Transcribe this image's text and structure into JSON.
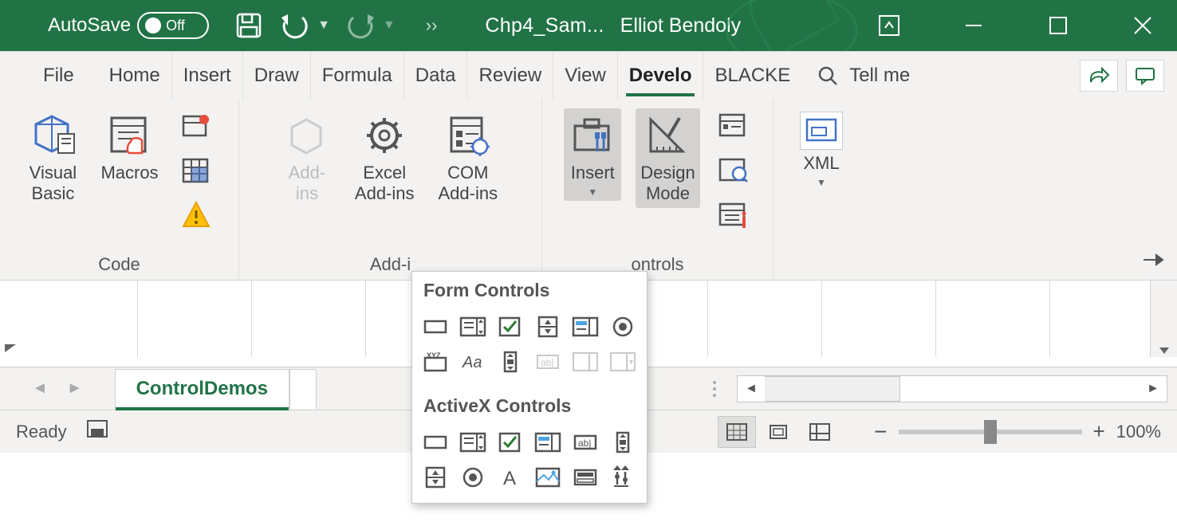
{
  "titlebar": {
    "autosave_label": "AutoSave",
    "autosave_state": "Off",
    "doc_title": "Chp4_Sam...",
    "user": "Elliot Bendoly"
  },
  "tabs": [
    "File",
    "Home",
    "Insert",
    "Draw",
    "Formula",
    "Data",
    "Review",
    "View",
    "Develo",
    "BLACKE"
  ],
  "active_tab_index": 8,
  "tell_me": "Tell me",
  "ribbon": {
    "code": {
      "visual_basic": "Visual\nBasic",
      "macros": "Macros",
      "label": "Code"
    },
    "addins": {
      "addins": "Add-\nins",
      "excel_addins": "Excel\nAdd-ins",
      "com_addins": "COM\nAdd-ins",
      "label": "Add-i"
    },
    "controls": {
      "insert": "Insert",
      "design_mode": "Design\nMode",
      "label": "ontrols"
    },
    "xml": {
      "xml": "XML"
    }
  },
  "dropdown": {
    "form_title": "Form Controls",
    "activex_title": "ActiveX Controls"
  },
  "sheet": {
    "active_tab": "ControlDemos"
  },
  "statusbar": {
    "ready": "Ready",
    "zoom": "100%"
  }
}
